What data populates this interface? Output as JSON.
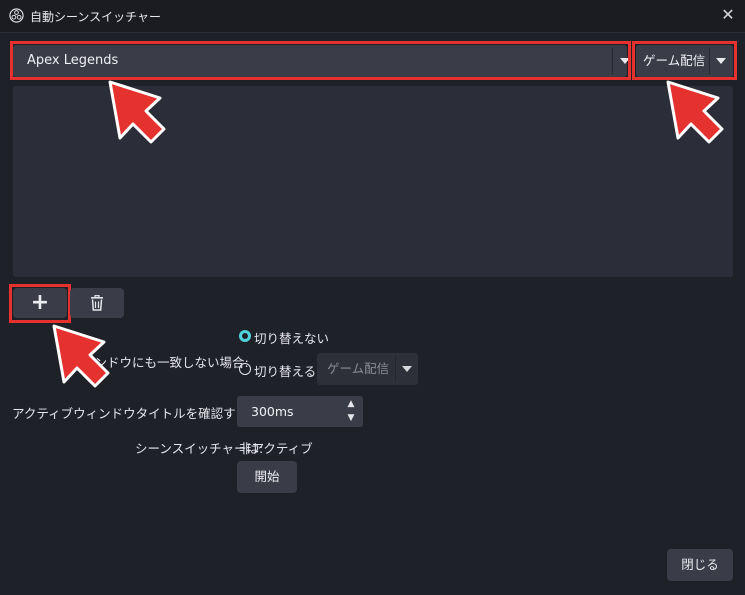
{
  "window": {
    "title": "自動シーンスイッチャー",
    "close_glyph": "✕"
  },
  "window_combo": {
    "value": "Apex Legends"
  },
  "scene_combo": {
    "value": "ゲーム配信"
  },
  "list": {
    "add_glyph": "+",
    "delete_icon": "trash-icon"
  },
  "no_match": {
    "label": "ィンドウにも一致しない場合:",
    "option_dont_switch": "切り替えない",
    "option_switch_to": "切り替える:",
    "switch_scene_value": "ゲーム配信",
    "selected": "dont_switch"
  },
  "interval": {
    "label": "アクティブウィンドウタイトルを確認する間隔:",
    "value": "300ms"
  },
  "status": {
    "label": "シーンスイッチャーは:",
    "value": "非アクティブ"
  },
  "buttons": {
    "start": "開始",
    "close": "閉じる"
  },
  "colors": {
    "highlight": "#e5322f",
    "radio_accent": "#4fd1dd",
    "background": "#1f2129"
  }
}
